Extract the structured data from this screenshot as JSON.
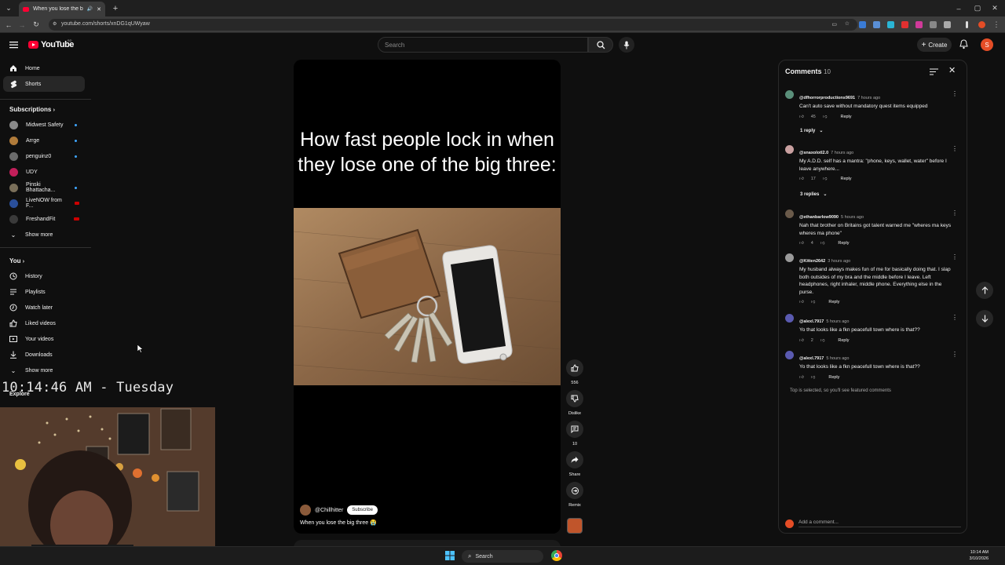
{
  "browser": {
    "tab_title": "When you lose the big thr...",
    "url": "youtube.com/shorts/xnDG1qUWyaw"
  },
  "header": {
    "logo_text": "YouTube",
    "logo_country": "BD",
    "search_placeholder": "Search",
    "create_label": "Create",
    "avatar_letter": "S"
  },
  "sidebar": {
    "main": [
      {
        "label": "Home",
        "icon": "home-icon"
      },
      {
        "label": "Shorts",
        "icon": "shorts-icon",
        "active": true
      }
    ],
    "subscriptions_heading": "Subscriptions",
    "subscriptions": [
      {
        "label": "Midwest Safety",
        "color": "#8a8a8a",
        "status": "dot"
      },
      {
        "label": "Arrge",
        "color": "#b07b3a",
        "status": "dot"
      },
      {
        "label": "penguinz0",
        "color": "#6b6b6b",
        "status": "dot"
      },
      {
        "label": "UDY",
        "color": "#c21f5a",
        "status": "none"
      },
      {
        "label": "Pinski Bhattacha...",
        "color": "#7a6f5a",
        "status": "dot"
      },
      {
        "label": "LiveNOW from F...",
        "color": "#2a4f9a",
        "status": "live"
      },
      {
        "label": "FreshandFit",
        "color": "#3a3a3a",
        "status": "live"
      }
    ],
    "show_more": "Show more",
    "you_heading": "You",
    "you_items": [
      {
        "label": "History",
        "icon": "history-icon"
      },
      {
        "label": "Playlists",
        "icon": "playlists-icon"
      },
      {
        "label": "Watch later",
        "icon": "watch-later-icon"
      },
      {
        "label": "Liked videos",
        "icon": "liked-videos-icon"
      },
      {
        "label": "Your videos",
        "icon": "your-videos-icon"
      },
      {
        "label": "Downloads",
        "icon": "downloads-icon"
      }
    ],
    "show_more_2": "Show more",
    "explore_heading": "Explore"
  },
  "overlay": {
    "clock": "10:14:46 AM - Tuesday"
  },
  "short": {
    "title": "How fast people lock in when they lose one of the big three:",
    "channel": "@Chillhitter",
    "subscribe": "Subscribe",
    "caption": "When you lose the big three 😭"
  },
  "actions": {
    "likes": "556",
    "dislike": "Dislike",
    "comments": "10",
    "share": "Share",
    "remix": "Remix"
  },
  "comments": {
    "title": "Comments",
    "count": "10",
    "reply_label": "Reply",
    "items": [
      {
        "user": "@dfhorrorproductions9691",
        "time": "7 hours ago",
        "text": "Can't auto save without mandatory quest items equipped",
        "likes": "45",
        "avatar": "#5a8f7a"
      },
      {
        "user": "@snaxolotl2.0",
        "time": "7 hours ago",
        "text": "My A.D.D. self has a mantra: \"phone, keys, wallet, water\" before I leave anywhere...",
        "likes": "17",
        "avatar": "#c9a0a0"
      },
      {
        "user": "@ethanbarlow9090",
        "time": "5 hours ago",
        "text": "Nah that brother on Britains got talent warned me \"wheres ma keys wheres ma phone\"",
        "likes": "4",
        "avatar": "#6a5a4a"
      },
      {
        "user": "@Kitten2642",
        "time": "3 hours ago",
        "text": "My husband always makes fun of me for basically doing that. I slap both outsides of my bra and the middle before I leave. Left headphones, right inhaler, middle phone. Everything else in the purse.",
        "likes": "",
        "avatar": "#9a9a9a"
      },
      {
        "user": "@alexl.7917",
        "time": "5 hours ago",
        "text": "Yo that looks like a fkn peacefull town where is that??",
        "likes": "2",
        "avatar": "#5a5ab0"
      },
      {
        "user": "@alexl.7917",
        "time": "5 hours ago",
        "text": "Yo that looks like a fkn peacefull town where is that??",
        "likes": "",
        "avatar": "#5a5ab0"
      }
    ],
    "reply_toggle_1": "1 reply",
    "reply_toggle_2": "3 replies",
    "footer_note": "Top is selected, so you'll see featured comments",
    "add_placeholder": "Add a comment..."
  },
  "taskbar": {
    "search": "Search",
    "time": "10:14 AM",
    "date": "3/10/2026"
  }
}
